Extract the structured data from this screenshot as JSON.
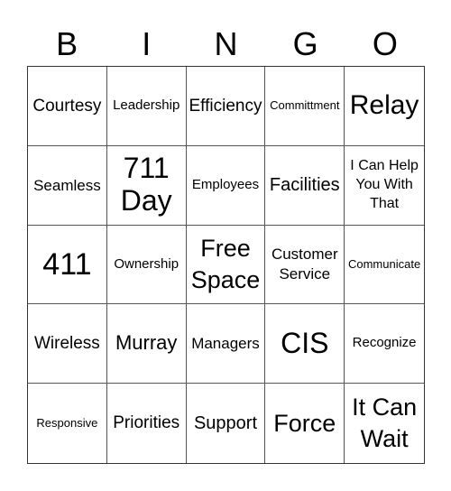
{
  "header": [
    "B",
    "I",
    "N",
    "G",
    "O"
  ],
  "rows": [
    [
      "Courtesy",
      "Leadership",
      "Efficiency",
      "Committment",
      "Relay"
    ],
    [
      "Seamless",
      "711 Day",
      "Employees",
      "Facilities",
      "I Can Help You With That"
    ],
    [
      "411",
      "Ownership",
      "Free Space",
      "Customer Service",
      "Communicate"
    ],
    [
      "Wireless",
      "Murray",
      "Managers",
      "CIS",
      "Recognize"
    ],
    [
      "Responsive",
      "Priorities",
      "Support",
      "Force",
      "It Can Wait"
    ]
  ]
}
